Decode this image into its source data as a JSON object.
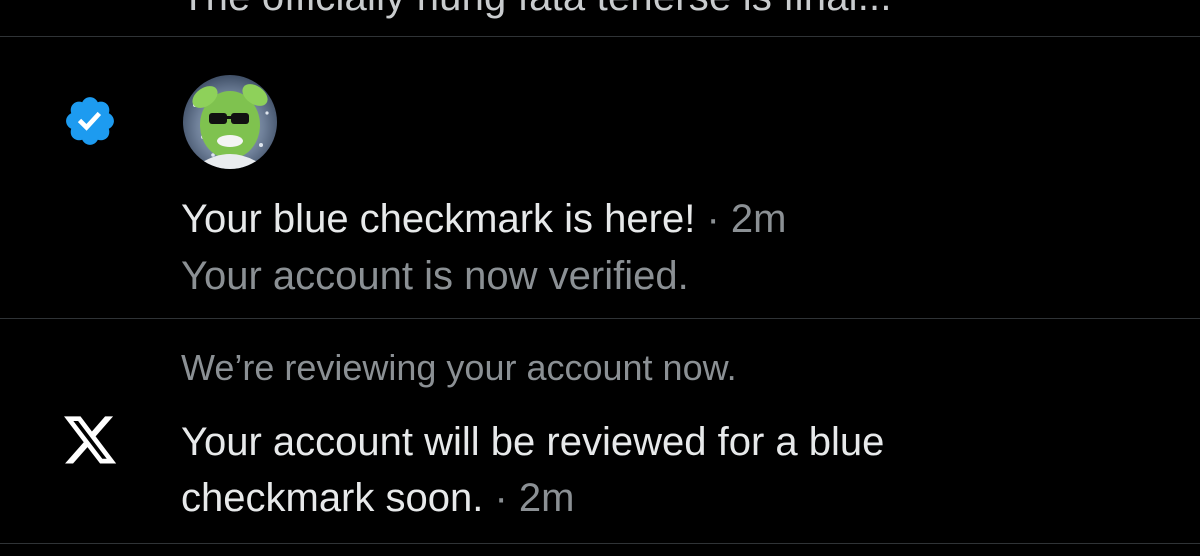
{
  "feed": {
    "truncated_previous_text": "The officially hung fata tenerse is final..."
  },
  "verified_notification": {
    "title": "Your blue checkmark is here!",
    "separator": "·",
    "time": "2m",
    "subtitle": "Your account is now verified.",
    "icon": "verified-badge-icon",
    "badge_color": "#1d9bf0"
  },
  "review_notification": {
    "preview": "We’re reviewing your account now.",
    "body": "Your account will be reviewed for a blue checkmark soon.",
    "separator": "·",
    "time": "2m",
    "icon": "x-logo-icon"
  },
  "colors": {
    "background": "#000000",
    "primary_text": "#e7e9ea",
    "secondary_text": "#8b9094",
    "divider": "#2f3336",
    "accent": "#1d9bf0"
  }
}
